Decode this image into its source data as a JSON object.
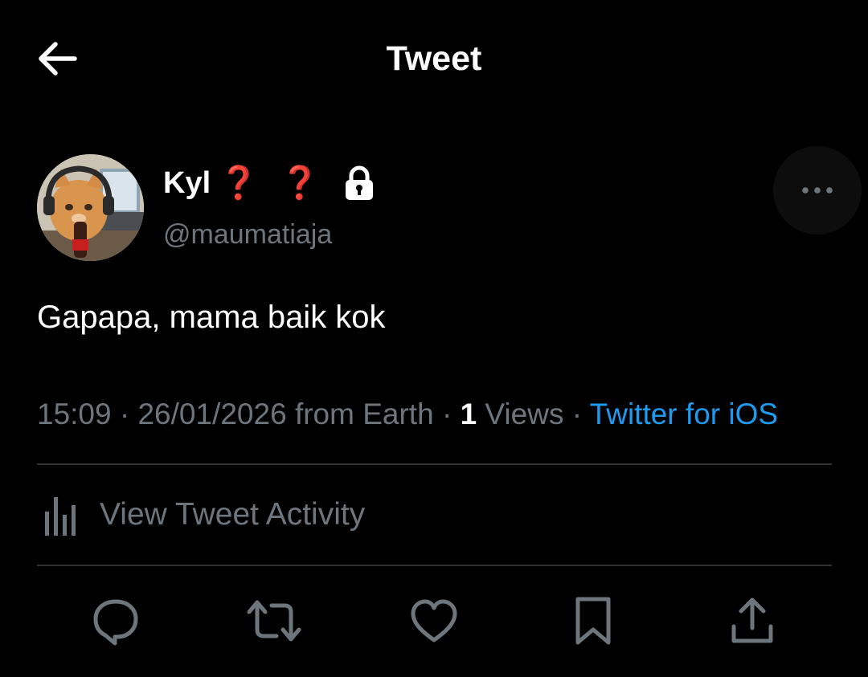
{
  "header": {
    "title": "Tweet",
    "back_icon": "arrow-left-icon"
  },
  "author": {
    "display_name": "Kyl",
    "emoji_1": "❓",
    "emoji_2": "❓",
    "lock_icon": "lock-icon",
    "handle": "@maumatiaja"
  },
  "more_icon": "more-horizontal-icon",
  "tweet": {
    "text": "Gapapa, mama baik kok",
    "time": "15:09",
    "sep1": " · ",
    "date": "26/01/2026",
    "from": " from Earth",
    "sep2": " · ",
    "views_count": "1",
    "views_label": " Views",
    "sep3": " · ",
    "source": "Twitter for iOS"
  },
  "activity": {
    "icon": "bar-chart-icon",
    "label": "View Tweet Activity"
  },
  "actions": {
    "reply_icon": "reply-icon",
    "retweet_icon": "retweet-icon",
    "like_icon": "heart-icon",
    "bookmark_icon": "bookmark-icon",
    "share_icon": "share-icon"
  },
  "colors": {
    "background": "#000000",
    "secondary_text": "#6e767d",
    "link": "#1d9bf0",
    "divider": "#2f3336"
  }
}
